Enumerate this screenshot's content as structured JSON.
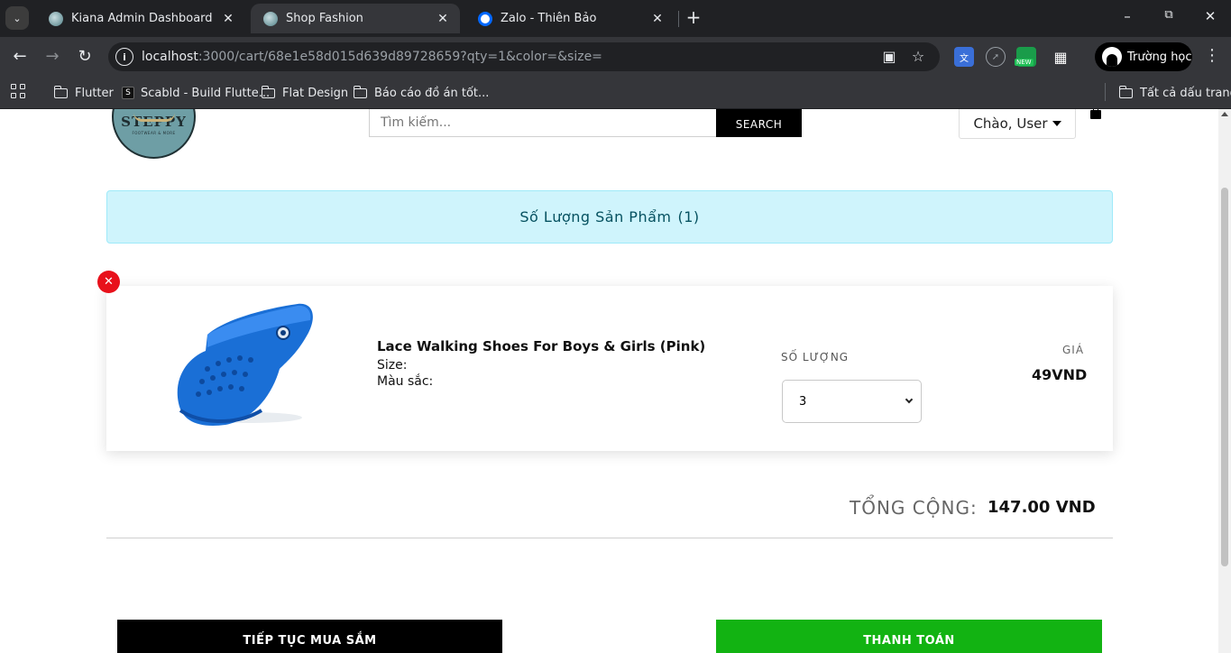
{
  "browser": {
    "tabs": [
      {
        "title": "Kiana Admin Dashboard",
        "active": false
      },
      {
        "title": "Shop Fashion",
        "active": true
      },
      {
        "title": "Zalo - Thiên Bảo",
        "active": false
      }
    ],
    "url_host": "localhost",
    "url_rest": ":3000/cart/68e1e58d015d639d89728659?qty=1&color=&size=",
    "profile_name": "Trường học",
    "extension_badge": "NEW",
    "bookmarks": [
      "Flutter",
      "Scabld - Build Flutte...",
      "Flat Design",
      "Báo cáo đồ án tốt..."
    ],
    "all_bookmarks": "Tất cả dấu trang"
  },
  "header": {
    "logo_text": "STEPPY",
    "logo_tagline": "FOOTWEAR & MORE",
    "search_placeholder": "Tìm kiếm...",
    "search_button": "SEARCH",
    "greeting": "Chào, User"
  },
  "cart": {
    "count_label": "Số Lượng Sản Phẩm",
    "count_value": "(1)",
    "item": {
      "name": "Lace Walking Shoes For Boys & Girls (Pink)",
      "size_label": "Size:",
      "color_label": "Màu sắc:",
      "qty_label": "SỐ LƯỢNG",
      "qty_value": "3",
      "price_label": "GIÁ",
      "price_value": "49VND",
      "image_color": "#1a6fd6"
    },
    "total_label": "TỔNG CỘNG:",
    "total_value": "147.00 VND",
    "continue_button": "TIẾP TỤC MUA SẮM",
    "checkout_button": "THANH TOÁN"
  },
  "colors": {
    "banner_bg": "#cff4fc",
    "banner_text": "#055160",
    "checkout": "#12b312",
    "remove": "#e8111b"
  }
}
